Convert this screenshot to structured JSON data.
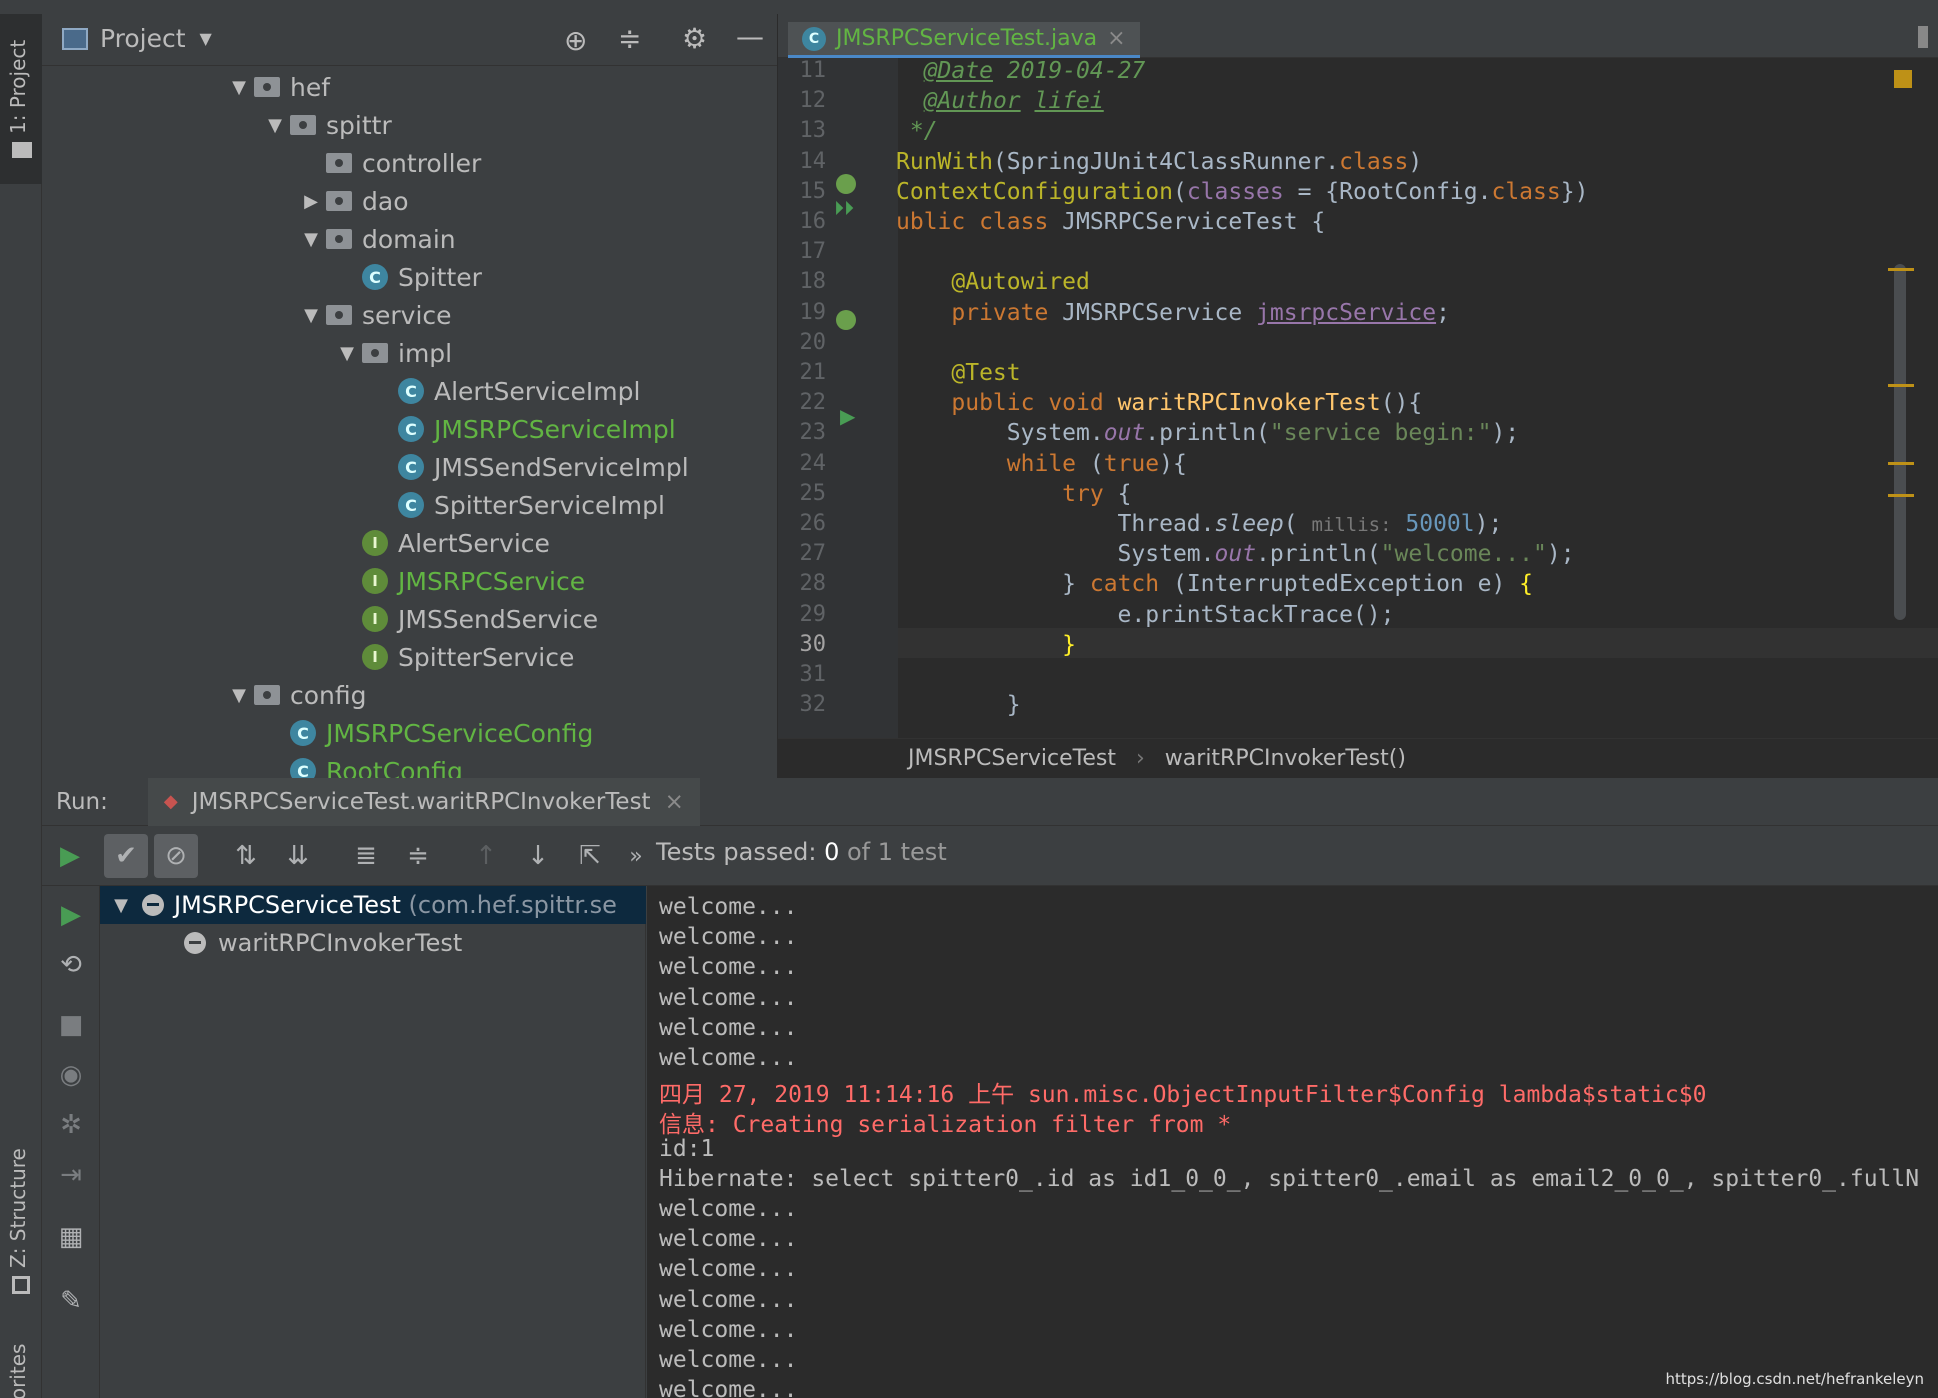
{
  "project_panel": {
    "title": "Project",
    "tree": [
      {
        "label": "hef",
        "type": "folder",
        "arrow": "▼",
        "indent": 0
      },
      {
        "label": "spittr",
        "type": "folder",
        "arrow": "▼",
        "indent": 1
      },
      {
        "label": "controller",
        "type": "folder",
        "arrow": "",
        "indent": 2
      },
      {
        "label": "dao",
        "type": "folder",
        "arrow": "▶",
        "indent": 2
      },
      {
        "label": "domain",
        "type": "folder",
        "arrow": "▼",
        "indent": 2
      },
      {
        "label": "Spitter",
        "type": "class",
        "arrow": "",
        "indent": 3
      },
      {
        "label": "service",
        "type": "folder",
        "arrow": "▼",
        "indent": 2
      },
      {
        "label": "impl",
        "type": "folder",
        "arrow": "▼",
        "indent": 3
      },
      {
        "label": "AlertServiceImpl",
        "type": "class",
        "arrow": "",
        "indent": 4
      },
      {
        "label": "JMSRPCServiceImpl",
        "type": "class",
        "arrow": "",
        "indent": 4,
        "highlight": true
      },
      {
        "label": "JMSSendServiceImpl",
        "type": "class",
        "arrow": "",
        "indent": 4
      },
      {
        "label": "SpitterServiceImpl",
        "type": "class",
        "arrow": "",
        "indent": 4
      },
      {
        "label": "AlertService",
        "type": "interface",
        "arrow": "",
        "indent": 3
      },
      {
        "label": "JMSRPCService",
        "type": "interface",
        "arrow": "",
        "indent": 3,
        "highlight": true
      },
      {
        "label": "JMSSendService",
        "type": "interface",
        "arrow": "",
        "indent": 3
      },
      {
        "label": "SpitterService",
        "type": "interface",
        "arrow": "",
        "indent": 3
      },
      {
        "label": "config",
        "type": "folder",
        "arrow": "▼",
        "indent": 0
      },
      {
        "label": "JMSRPCServiceConfig",
        "type": "class",
        "arrow": "",
        "indent": 1,
        "highlight": true
      },
      {
        "label": "RootConfig",
        "type": "class",
        "arrow": "",
        "indent": 1,
        "highlight": true
      }
    ]
  },
  "left_strip": {
    "project_tab": "1: Project",
    "structure_tab": "Z: Structure",
    "favorites_tab": "vorites"
  },
  "editor": {
    "tab_label": "JMSRPCServiceTest.java",
    "tab_close": "×",
    "lines": [
      {
        "n": "11",
        "html": "<span class='doc'>  <u>@Date</u> 2019-04-27</span>"
      },
      {
        "n": "12",
        "html": "<span class='doc'>  <u>@Author</u> <u>lifei</u></span>"
      },
      {
        "n": "13",
        "html": "<span class='doc'> */</span>"
      },
      {
        "n": "14",
        "html": "<span class='an'>RunWith</span>(SpringJUnit4ClassRunner.<span class='kw'>class</span>)"
      },
      {
        "n": "15",
        "html": "<span class='an'>ContextConfiguration</span>(<span class='fld'>classes</span> = {RootConfig.<span class='kw'>class</span>})"
      },
      {
        "n": "16",
        "html": "<span class='kw'>ublic class</span> JMSRPCServiceTest {"
      },
      {
        "n": "17",
        "html": ""
      },
      {
        "n": "18",
        "html": "    <span class='an'>@Autowired</span>"
      },
      {
        "n": "19",
        "html": "    <span class='kw'>private</span> JMSRPCService <span class='fld'><u>jmsrpcService</u></span>;"
      },
      {
        "n": "20",
        "html": ""
      },
      {
        "n": "21",
        "html": "    <span class='an'>@Test</span>"
      },
      {
        "n": "22",
        "html": "    <span class='kw'>public void</span> <span class='fn'>waritRPCInvokerTest</span>(){"
      },
      {
        "n": "23",
        "html": "        System.<span class='fld'><i>out</i></span>.println(<span class='st'>\"service begin:\"</span>);"
      },
      {
        "n": "24",
        "html": "        <span class='kw'>while</span> (<span class='kw'>true</span>){"
      },
      {
        "n": "25",
        "html": "            <span class='kw'>try</span> {"
      },
      {
        "n": "26",
        "html": "                Thread.<i>sleep</i>( <span style='color:#787878;font-size:19px'>millis:</span> <span class='num'>5000l</span>);"
      },
      {
        "n": "27",
        "html": "                System.<span class='fld'><i>out</i></span>.println(<span class='st'>\"welcome...\"</span>);"
      },
      {
        "n": "28",
        "html": "            } <span class='kw'>catch</span> (InterruptedException e) <span style='color:#ffef28'>{</span>"
      },
      {
        "n": "29",
        "html": "                e.printStackTrace();"
      },
      {
        "n": "30",
        "html": "            <span style='color:#ffef28'>}</span>"
      },
      {
        "n": "31",
        "html": ""
      },
      {
        "n": "32",
        "html": "        }"
      }
    ],
    "breadcrumb": [
      "JMSRPCServiceTest",
      "waritRPCInvokerTest()"
    ],
    "breadcrumb_sep": "›"
  },
  "run": {
    "label": "Run:",
    "tab": "JMSRPCServiceTest.waritRPCInvokerTest",
    "tab_close": "×",
    "status_prefix": "Tests passed: ",
    "status_count": "0",
    "status_suffix": " of 1 test",
    "tree_root": "JMSRPCServiceTest",
    "tree_root_pkg": "(com.hef.spittr.se",
    "tree_child": "waritRPCInvokerTest",
    "console": [
      {
        "t": "welcome...",
        "c": ""
      },
      {
        "t": "welcome...",
        "c": ""
      },
      {
        "t": "welcome...",
        "c": ""
      },
      {
        "t": "welcome...",
        "c": ""
      },
      {
        "t": "welcome...",
        "c": ""
      },
      {
        "t": "welcome...",
        "c": ""
      },
      {
        "t": "四月 27, 2019 11:14:16 上午 sun.misc.ObjectInputFilter$Config lambda$static$0",
        "c": "red"
      },
      {
        "t": "信息: Creating serialization filter from *",
        "c": "red"
      },
      {
        "t": "id:1",
        "c": ""
      },
      {
        "t": "Hibernate: select spitter0_.id as id1_0_0_, spitter0_.email as email2_0_0_, spitter0_.fullN",
        "c": ""
      },
      {
        "t": "welcome...",
        "c": ""
      },
      {
        "t": "welcome...",
        "c": ""
      },
      {
        "t": "welcome...",
        "c": ""
      },
      {
        "t": "welcome...",
        "c": ""
      },
      {
        "t": "welcome...",
        "c": ""
      },
      {
        "t": "welcome...",
        "c": ""
      },
      {
        "t": "welcome...",
        "c": ""
      }
    ]
  },
  "watermark": "https://blog.csdn.net/hefrankeleyn"
}
